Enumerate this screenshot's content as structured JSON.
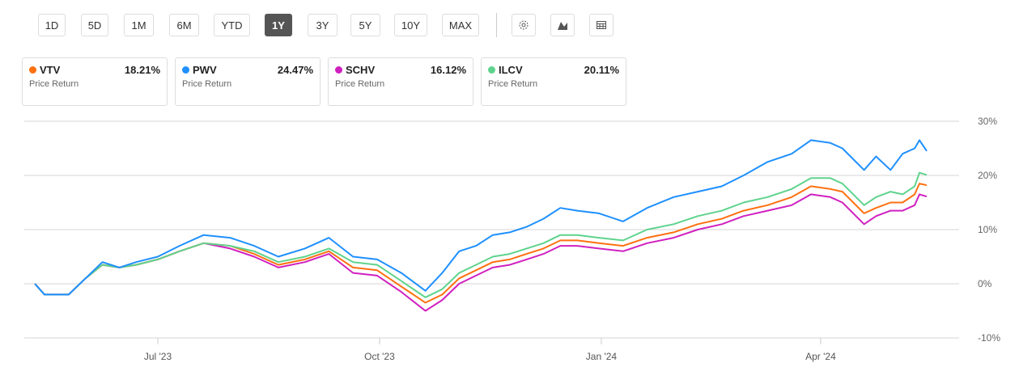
{
  "range_buttons": [
    "1D",
    "5D",
    "1M",
    "6M",
    "YTD",
    "1Y",
    "3Y",
    "5Y",
    "10Y",
    "MAX"
  ],
  "active_range": "1Y",
  "tool_buttons": [
    "gear-icon",
    "chart-type-icon",
    "table-icon"
  ],
  "cards": [
    {
      "ticker": "VTV",
      "value": "18.21%",
      "sub": "Price Return",
      "color": "#ff7010"
    },
    {
      "ticker": "PWV",
      "value": "24.47%",
      "sub": "Price Return",
      "color": "#1e90ff"
    },
    {
      "ticker": "SCHV",
      "value": "16.12%",
      "sub": "Price Return",
      "color": "#d020c0"
    },
    {
      "ticker": "ILCV",
      "value": "20.11%",
      "sub": "Price Return",
      "color": "#5fd38d"
    }
  ],
  "chart_data": {
    "type": "line",
    "ylim": [
      -10,
      30
    ],
    "yticks": [
      "30%",
      "20%",
      "10%",
      "0%",
      "-10%"
    ],
    "ytick_values": [
      30,
      20,
      10,
      0,
      -10
    ],
    "xticks": [
      {
        "label": "Jul '23",
        "date": "2023-07-01"
      },
      {
        "label": "Oct '23",
        "date": "2023-10-01"
      },
      {
        "label": "Jan '24",
        "date": "2024-01-01"
      },
      {
        "label": "Apr '24",
        "date": "2024-04-01"
      }
    ],
    "x": [
      "2023-05-11",
      "2023-05-15",
      "2023-05-25",
      "2023-06-01",
      "2023-06-08",
      "2023-06-15",
      "2023-06-22",
      "2023-07-01",
      "2023-07-10",
      "2023-07-20",
      "2023-07-31",
      "2023-08-10",
      "2023-08-20",
      "2023-08-31",
      "2023-09-10",
      "2023-09-20",
      "2023-09-30",
      "2023-10-10",
      "2023-10-20",
      "2023-10-27",
      "2023-11-03",
      "2023-11-10",
      "2023-11-17",
      "2023-11-24",
      "2023-12-01",
      "2023-12-08",
      "2023-12-15",
      "2023-12-22",
      "2023-12-31",
      "2024-01-10",
      "2024-01-20",
      "2024-01-31",
      "2024-02-10",
      "2024-02-20",
      "2024-02-29",
      "2024-03-10",
      "2024-03-20",
      "2024-03-28",
      "2024-04-05",
      "2024-04-10",
      "2024-04-19",
      "2024-04-24",
      "2024-04-30",
      "2024-05-05",
      "2024-05-10",
      "2024-05-12",
      "2024-05-15"
    ],
    "series": [
      {
        "name": "VTV",
        "color": "#ff7010",
        "values": [
          0,
          -2,
          -2,
          1,
          3.5,
          3,
          3.5,
          4.5,
          6,
          7.5,
          7,
          5.5,
          3.5,
          4.5,
          6,
          3,
          2.5,
          -0.5,
          -3.5,
          -2,
          1,
          2.5,
          4,
          4.5,
          5.5,
          6.5,
          8,
          8,
          7.5,
          7,
          8.5,
          9.5,
          11,
          12,
          13.5,
          14.5,
          16,
          18,
          17.5,
          17,
          13,
          14,
          15,
          15,
          16.5,
          18.5,
          18.2
        ]
      },
      {
        "name": "PWV",
        "color": "#1e90ff",
        "values": [
          0,
          -2,
          -2,
          1,
          4,
          3,
          4,
          5,
          7,
          9,
          8.5,
          7,
          5,
          6.5,
          8.5,
          5,
          4.5,
          2,
          -1.3,
          2,
          6,
          7,
          9,
          9.5,
          10.5,
          12,
          14,
          13.5,
          13,
          11.5,
          14,
          16,
          17,
          18,
          20,
          22.5,
          24,
          26.5,
          26,
          25,
          21,
          23.5,
          21,
          24,
          25,
          26.5,
          24.5
        ]
      },
      {
        "name": "SCHV",
        "color": "#d020c0",
        "values": [
          0,
          -2,
          -2,
          1,
          3.5,
          3,
          3.5,
          4.5,
          6,
          7.5,
          6.5,
          5,
          3,
          4,
          5.5,
          2,
          1.5,
          -1.5,
          -5,
          -3,
          0,
          1.5,
          3,
          3.5,
          4.5,
          5.5,
          7,
          7,
          6.5,
          6,
          7.5,
          8.5,
          10,
          11,
          12.5,
          13.5,
          14.5,
          16.5,
          16,
          15,
          11,
          12.5,
          13.5,
          13.5,
          14.5,
          16.5,
          16.1
        ]
      },
      {
        "name": "ILCV",
        "color": "#5fd38d",
        "values": [
          0,
          -2,
          -2,
          1,
          3.5,
          3,
          3.5,
          4.5,
          6,
          7.5,
          7,
          6,
          4,
          5,
          6.5,
          4,
          3.5,
          0.5,
          -2.5,
          -1,
          2,
          3.5,
          5,
          5.5,
          6.5,
          7.5,
          9,
          9,
          8.5,
          8,
          10,
          11,
          12.5,
          13.5,
          15,
          16,
          17.5,
          19.5,
          19.5,
          18.5,
          14.5,
          16,
          17,
          16.5,
          18,
          20.5,
          20.1
        ]
      }
    ]
  }
}
